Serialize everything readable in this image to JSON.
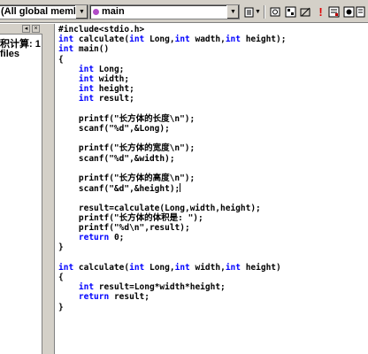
{
  "toolbar": {
    "scope_combo": "(All global members",
    "member_combo": "main",
    "icons": [
      "dropdown-list-icon",
      "go-to-definition-icon",
      "compile-icon",
      "build-icon",
      "stop-build-icon",
      "execute-icon",
      "breakpoint-icon",
      "debug-go-icon"
    ]
  },
  "left_panel": {
    "line1": "积计算: 1",
    "line2": "files"
  },
  "colors": {
    "keyword": "#0000ff",
    "chrome": "#d4d0c8",
    "member_dot": "#b14cc8"
  },
  "code": [
    {
      "k": "",
      "t": "#include<stdio.h>"
    },
    {
      "k": "int",
      "t": " calculate(int Long,int wadth,int height);"
    },
    {
      "k": "int",
      "t": " main()"
    },
    {
      "k": "",
      "t": "{"
    },
    {
      "k": "",
      "t": "    int Long;"
    },
    {
      "k": "",
      "t": "    int width;"
    },
    {
      "k": "",
      "t": "    int height;"
    },
    {
      "k": "",
      "t": "    int result;"
    },
    {
      "k": "",
      "t": ""
    },
    {
      "k": "",
      "t": "    printf(\"长方体的长度\\n\");"
    },
    {
      "k": "",
      "t": "    scanf(\"%d\",&Long);"
    },
    {
      "k": "",
      "t": ""
    },
    {
      "k": "",
      "t": "    printf(\"长方体的宽度\\n\");"
    },
    {
      "k": "",
      "t": "    scanf(\"%d\",&width);"
    },
    {
      "k": "",
      "t": ""
    },
    {
      "k": "",
      "t": "    printf(\"长方体的高度\\n\");"
    },
    {
      "k": "",
      "t": "    scanf(\"&d\",&height);"
    },
    {
      "k": "",
      "t": ""
    },
    {
      "k": "",
      "t": "    result=calculate(Long,width,height);"
    },
    {
      "k": "",
      "t": "    printf(\"长方体的体积是: \");"
    },
    {
      "k": "",
      "t": "    printf(\"%d\\n\",result);"
    },
    {
      "k": "",
      "t": "    return 0;"
    },
    {
      "k": "",
      "t": "}"
    },
    {
      "k": "",
      "t": ""
    },
    {
      "k": "int",
      "t": " calculate(int Long,int width,int height)"
    },
    {
      "k": "",
      "t": "{"
    },
    {
      "k": "",
      "t": "    int result=Long*width*height;"
    },
    {
      "k": "",
      "t": "    return result;"
    },
    {
      "k": "",
      "t": "}"
    }
  ]
}
